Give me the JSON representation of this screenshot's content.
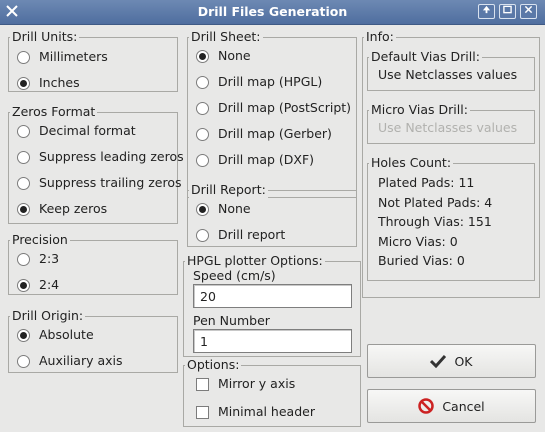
{
  "window": {
    "title": "Drill Files Generation",
    "icons": {
      "app": "x-app-icon",
      "buttons": [
        "arrow-up-icon",
        "maximize-icon",
        "close-icon"
      ]
    }
  },
  "drill_units": {
    "label": "Drill Units:",
    "options": [
      "Millimeters",
      "Inches"
    ],
    "selected": 1
  },
  "zeros_format": {
    "label": "Zeros Format",
    "options": [
      "Decimal format",
      "Suppress leading zeros",
      "Suppress trailing zeros",
      "Keep zeros"
    ],
    "selected": 3
  },
  "precision": {
    "label": "Precision",
    "options": [
      "2:3",
      "2:4"
    ],
    "selected": 1
  },
  "drill_origin": {
    "label": "Drill Origin:",
    "options": [
      "Absolute",
      "Auxiliary axis"
    ],
    "selected": 0
  },
  "drill_sheet": {
    "label": "Drill Sheet:",
    "options": [
      "None",
      "Drill map (HPGL)",
      "Drill map (PostScript)",
      "Drill map (Gerber)",
      "Drill map (DXF)"
    ],
    "selected": 0
  },
  "drill_report": {
    "label": "Drill Report:",
    "options": [
      "None",
      "Drill report"
    ],
    "selected": 0
  },
  "hpgl": {
    "label": "HPGL plotter Options:",
    "speed_label": "Speed (cm/s)",
    "speed_value": "20",
    "pen_label": "Pen Number",
    "pen_value": "1"
  },
  "options": {
    "label": "Options:",
    "mirror_y": "Mirror y axis",
    "minimal_header": "Minimal header"
  },
  "info": {
    "label": "Info:",
    "default_vias_label": "Default Vias Drill:",
    "default_vias_value": "Use Netclasses values",
    "micro_vias_label": "Micro Vias Drill:",
    "micro_vias_value": "Use Netclasses values",
    "holes_label": "Holes Count:",
    "holes": [
      "Plated Pads: 11",
      "Not Plated Pads: 4",
      "Through Vias: 151",
      "Micro Vias: 0",
      "Buried Vias: 0"
    ]
  },
  "buttons": {
    "ok": "OK",
    "cancel": "Cancel"
  },
  "colors": {
    "ok_check": "#333333",
    "cancel_icon": "#cc2222",
    "titlebar": "#5a78a8"
  }
}
